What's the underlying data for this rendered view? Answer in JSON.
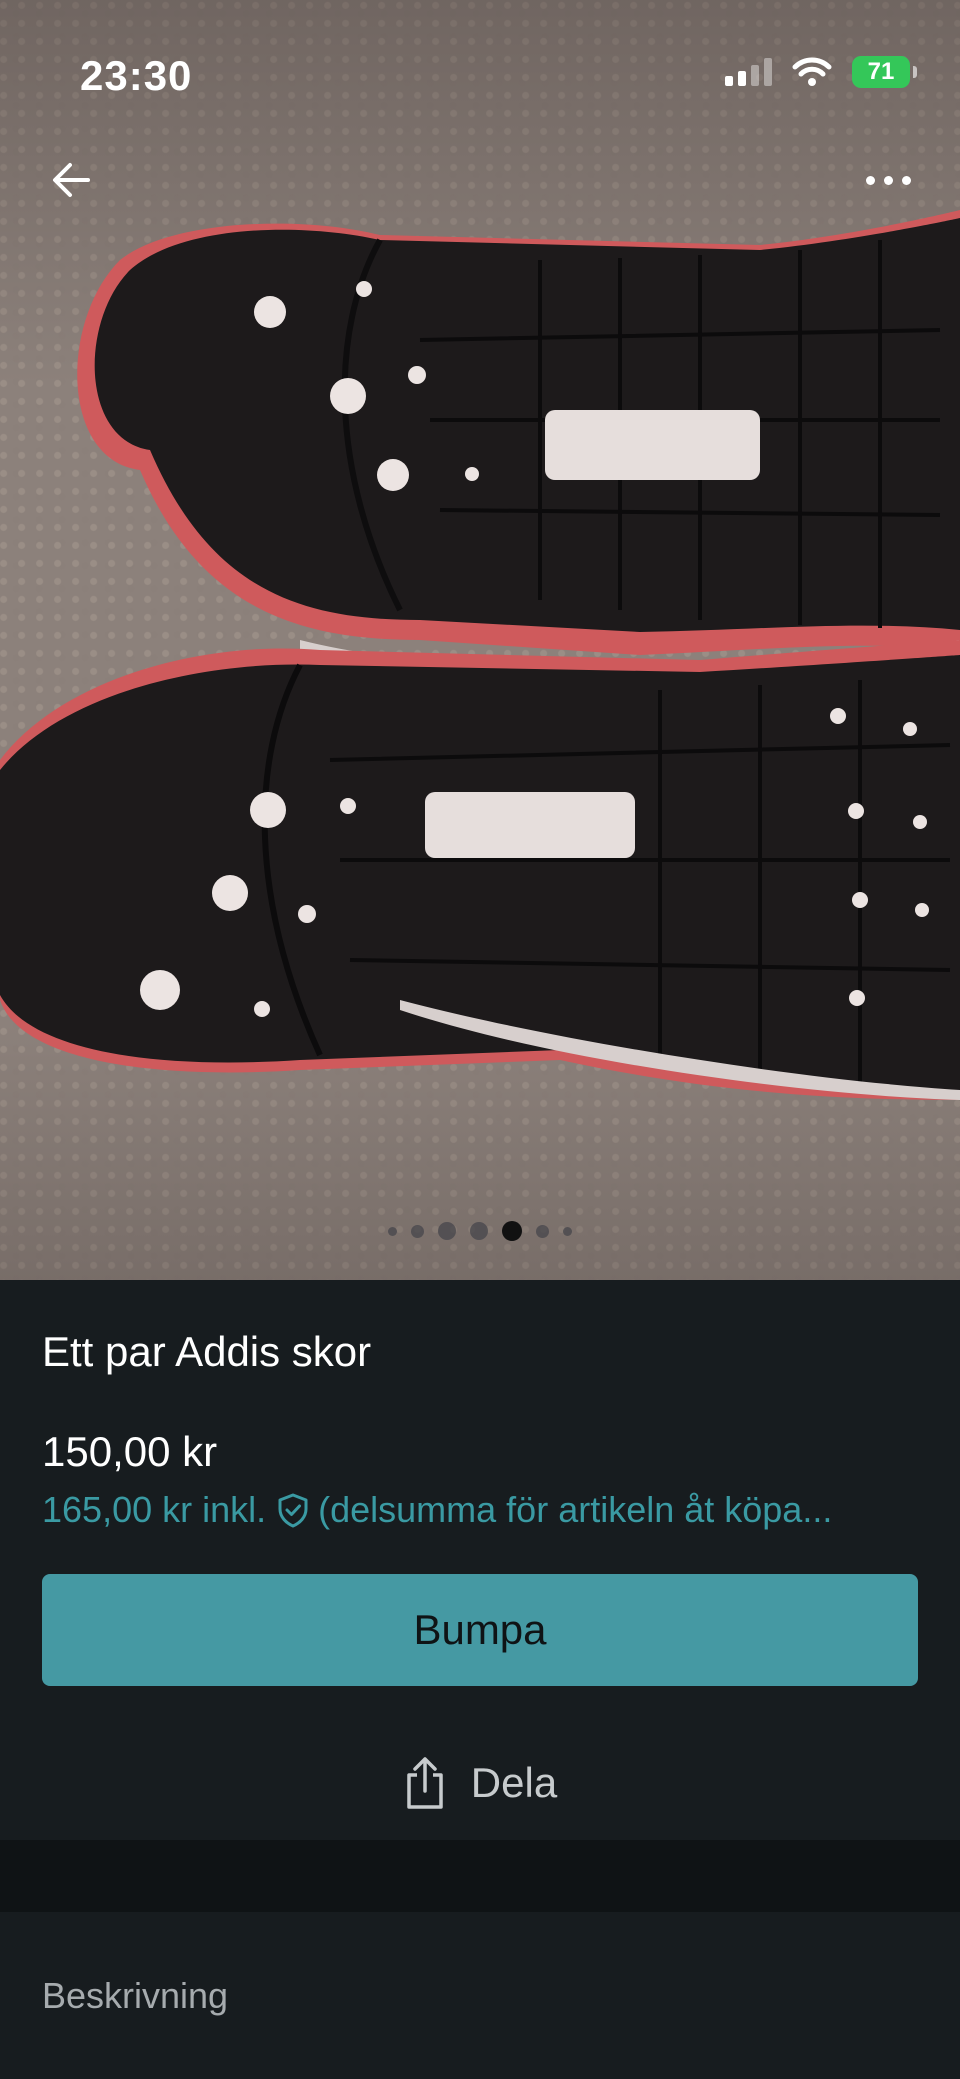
{
  "status_bar": {
    "time": "23:30",
    "battery": "71"
  },
  "photo": {
    "page_count": 7,
    "active_index": 4
  },
  "item": {
    "title": "Ett par Addis skor",
    "price": "150,00 kr",
    "price_incl_amount": "165,00 kr inkl.",
    "price_incl_note": "(delsumma för artikeln åt köpa..."
  },
  "actions": {
    "bump_label": "Bumpa",
    "share_label": "Dela"
  },
  "sections": {
    "description_label": "Beskrivning"
  },
  "colors": {
    "accent": "#4599a3",
    "link": "#3a9aa3",
    "panel_bg": "#171c1f",
    "battery": "#34c759"
  }
}
